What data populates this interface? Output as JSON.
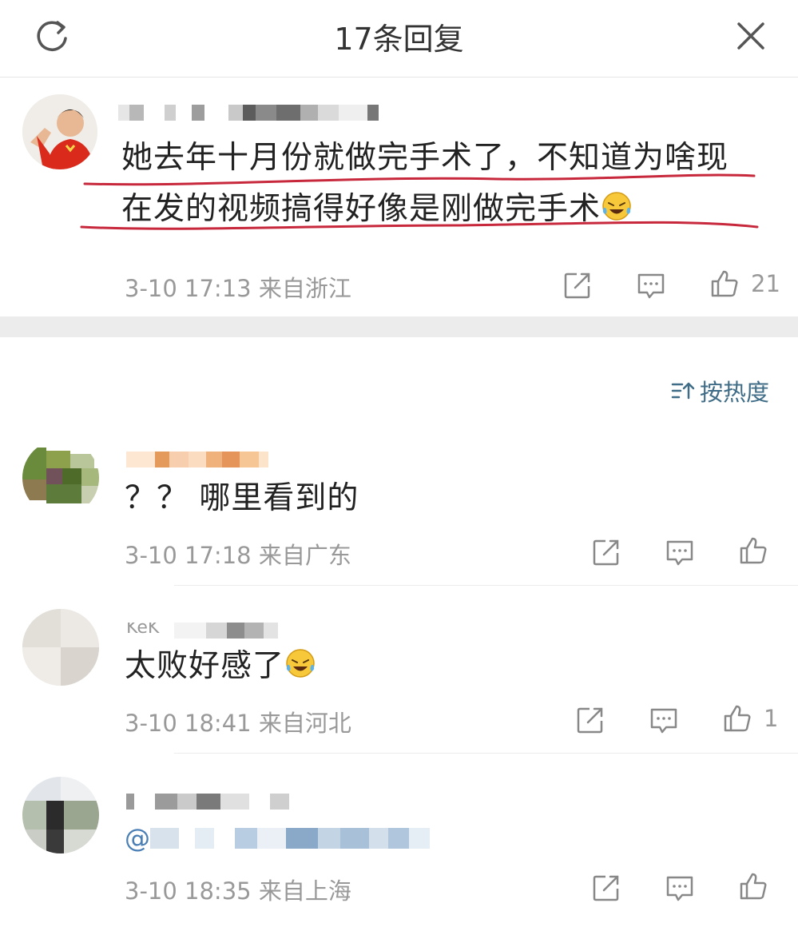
{
  "header": {
    "title": "17条回复",
    "refresh_icon": "refresh-icon",
    "close_icon": "close-icon"
  },
  "main_comment": {
    "line1": "她去年十月份就做完手术了，不知道为啥现",
    "line2": "在发的视频搞得好像是刚做完手术",
    "emoji": "laughing-tears-emoji",
    "meta": "3-10 17:13 来自浙江",
    "likes": "21",
    "underline_color": "#c8283c"
  },
  "sort": {
    "label": "按热度",
    "icon": "sort-icon",
    "color": "#3f6c86"
  },
  "replies": [
    {
      "text": "？？ 哪里看到的",
      "meta": "3-10 17:18 来自广东",
      "likes": ""
    },
    {
      "name_partial": "KeK",
      "text": "太败好感了",
      "emoji": "laughing-tears-emoji",
      "meta": "3-10 18:41 来自河北",
      "likes": "1"
    },
    {
      "text_partial": "@",
      "meta": "3-10 18:35 来自上海",
      "likes": ""
    }
  ],
  "icons": {
    "share": "share-icon",
    "comment": "comment-icon",
    "like": "thumbs-up-icon"
  }
}
